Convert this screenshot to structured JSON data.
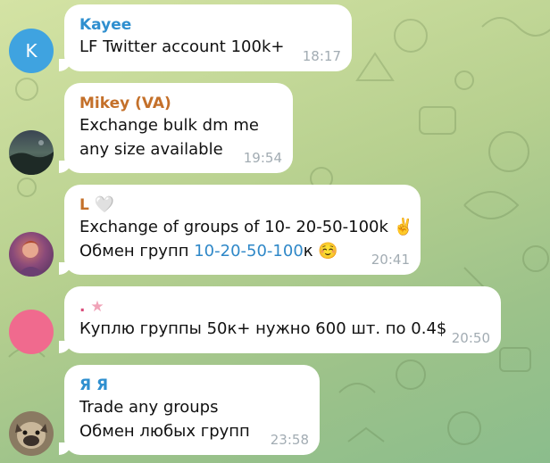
{
  "messages": [
    {
      "sender": "Kayee",
      "sender_color": "#2f8fcf",
      "avatar_letter": "K",
      "lines": [
        "LF Twitter account 100k+"
      ],
      "time": "18:17"
    },
    {
      "sender": "Mikey (VA)",
      "sender_color": "#c4702a",
      "lines": [
        "Exchange bulk dm me",
        "any size available"
      ],
      "time": "19:54"
    },
    {
      "sender": "L",
      "sender_emoji": "🤍",
      "sender_color": "#c4702a",
      "lines": [
        "Exchange of groups of 10- 20-50-100k"
      ],
      "line1_emoji": "✌️",
      "line2_prefix": "Обмен групп ",
      "line2_link": "10-20-50-100",
      "line2_suffix": "к",
      "line2_emoji": "☺️",
      "time": "20:41"
    },
    {
      "sender": ".",
      "sender_emoji": "★",
      "sender_color": "#d94b7a",
      "lines": [
        "Куплю группы 50к+ нужно 600 шт. по 0.4$"
      ],
      "time": "20:50"
    },
    {
      "sender": "Я Я",
      "sender_color": "#2f8fcf",
      "lines": [
        "Trade any groups",
        "Обмен любых групп"
      ],
      "time": "23:58"
    }
  ]
}
